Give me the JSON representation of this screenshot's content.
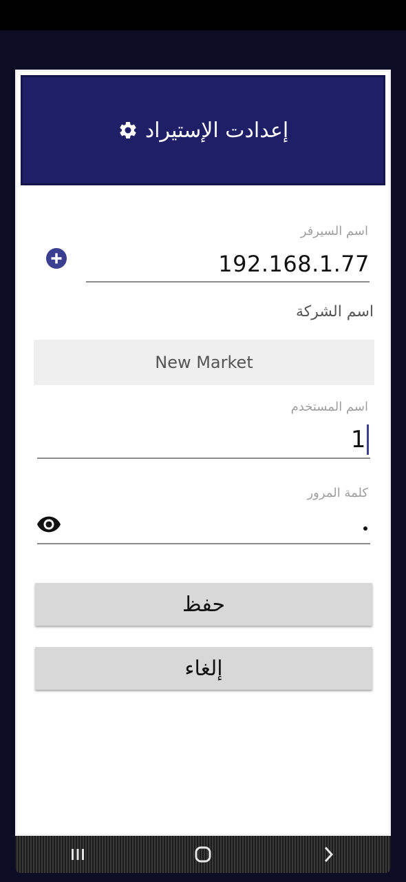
{
  "dialog": {
    "title": "إعدادت الإستيراد",
    "title_icon": "gear-icon"
  },
  "server": {
    "label": "اسم السيرفر",
    "value": "192.168.1.77",
    "add_icon": "plus-circle-icon"
  },
  "company": {
    "label": "اسم الشركة",
    "value": "New Market"
  },
  "username": {
    "label": "اسم المستخدم",
    "value": "1"
  },
  "password": {
    "label": "كلمة المرور",
    "visibility_icon": "eye-icon"
  },
  "buttons": {
    "save": "حفظ",
    "cancel": "إلغاء"
  },
  "navigation": {
    "recents_icon": "recents-icon",
    "home_icon": "home-icon",
    "back_icon": "back-icon"
  },
  "colors": {
    "header": "#1e1f66",
    "accent": "#3b3f8f",
    "button": "#d8d8d8"
  }
}
